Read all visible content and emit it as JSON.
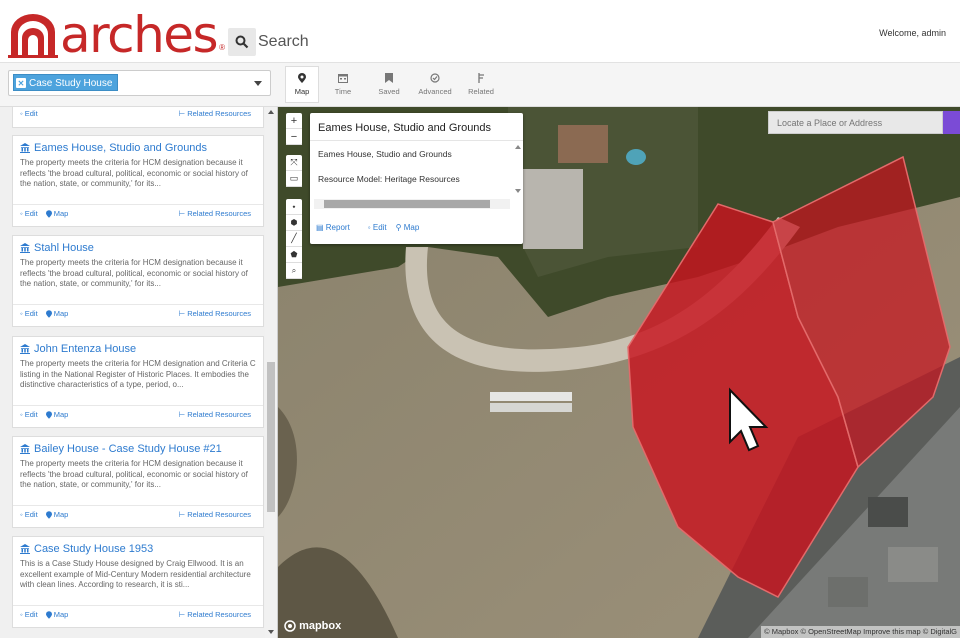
{
  "header": {
    "logo_text": "arches",
    "search_label": "Search",
    "welcome": "Welcome, admin"
  },
  "toolbar": {
    "filter_chip": "Case Study House",
    "tabs": [
      {
        "label": "Map",
        "icon": "map-marker-icon",
        "active": true
      },
      {
        "label": "Time",
        "icon": "calendar-icon",
        "active": false
      },
      {
        "label": "Saved",
        "icon": "bookmark-icon",
        "active": false
      },
      {
        "label": "Advanced",
        "icon": "check-circle-icon",
        "active": false
      },
      {
        "label": "Related",
        "icon": "related-icon",
        "active": false
      }
    ]
  },
  "results": {
    "partial": {
      "edit": "◦ Edit",
      "related": "Related Resources"
    },
    "cards": [
      {
        "title": "Eames House, Studio and Grounds",
        "desc": "The property meets the criteria for HCM designation because it reflects 'the broad cultural, political, economic or social history of the nation, state, or community,' for its...",
        "edit": "◦ Edit",
        "map": "Map",
        "related": "Related Resources"
      },
      {
        "title": "Stahl House",
        "desc": "The property meets the criteria for HCM designation because it reflects 'the broad cultural, political, economic or social history of the nation, state, or community,' for its...",
        "edit": "◦ Edit",
        "map": "Map",
        "related": "Related Resources"
      },
      {
        "title": "John Entenza House",
        "desc": "The property meets the criteria for HCM designation and Criteria C listing in the National Register of Historic Places. It embodies the distinctive characteristics of a type, period, o...",
        "edit": "◦ Edit",
        "map": "Map",
        "related": "Related Resources"
      },
      {
        "title": "Bailey House - Case Study House #21",
        "desc": "The property meets the criteria for HCM designation because it reflects 'the broad cultural, political, economic or social history of the nation, state, or community,' for its...",
        "edit": "◦ Edit",
        "map": "Map",
        "related": "Related Resources"
      },
      {
        "title": "Case Study House 1953",
        "desc": "This is a Case Study House designed by Craig Ellwood. It is an excellent example of Mid-Century Modern residential architecture with clean lines. According to research, it is sti...",
        "edit": "◦ Edit",
        "map": "Map",
        "related": "Related Resources"
      }
    ]
  },
  "map": {
    "popup": {
      "title": "Eames House, Studio and Grounds",
      "name": "Eames House, Studio and Grounds",
      "model": "Resource Model: Heritage Resources",
      "report": "Report",
      "edit": "◦ Edit",
      "map": "Map"
    },
    "locate_placeholder": "Locate a Place or Address",
    "mapbox": "mapbox",
    "attribution": "© Mapbox © OpenStreetMap Improve this map © DigitalG"
  },
  "colors": {
    "accent": "#c62828",
    "link": "#2e7bcf",
    "chip": "#4da3dd",
    "polygon": "#c8141e"
  }
}
